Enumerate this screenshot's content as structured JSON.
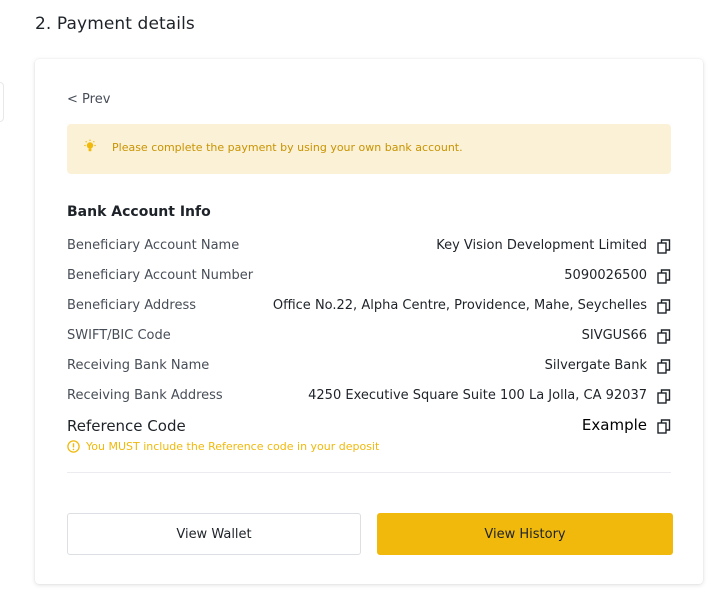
{
  "section": {
    "title": "2. Payment details"
  },
  "nav": {
    "prev_label": "< Prev"
  },
  "notice": {
    "icon": "lightbulb-icon",
    "text": "Please complete the payment by using your own bank account.",
    "background": "#fbf1d7",
    "text_color": "#c99400"
  },
  "bank_info": {
    "title": "Bank Account Info",
    "copy_icon": "copy-icon",
    "rows": [
      {
        "label": "Beneficiary Account Name",
        "value": "Key Vision Development Limited"
      },
      {
        "label": "Beneficiary Account Number",
        "value": "5090026500"
      },
      {
        "label": "Beneficiary Address",
        "value": "Office No.22, Alpha Centre, Providence, Mahe, Seychelles"
      },
      {
        "label": "SWIFT/BIC Code",
        "value": "SIVGUS66"
      },
      {
        "label": "Receiving Bank Name",
        "value": "Silvergate Bank"
      },
      {
        "label": "Receiving Bank Address",
        "value": "4250 Executive Square Suite 100 La Jolla, CA 92037"
      }
    ],
    "reference": {
      "label": "Reference Code",
      "value": "Example",
      "warning_icon": "warning-circle-icon",
      "warning": "You MUST include the Reference code in your deposit",
      "warning_color": "#f0b90b"
    }
  },
  "actions": {
    "wallet_label": "View Wallet",
    "history_label": "View History",
    "accent": "#f0b90b"
  }
}
